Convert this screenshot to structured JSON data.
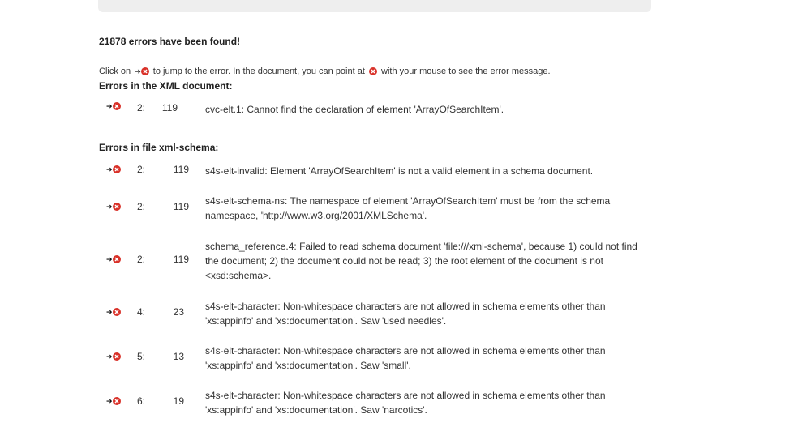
{
  "summary": "21878 errors have been found!",
  "hint": {
    "before": "Click on",
    "middle": "to jump to the error. In the document, you can point at",
    "after": "with your mouse to see the error message."
  },
  "xml_section": {
    "title": "Errors in the XML document:",
    "errors": [
      {
        "line": "2:",
        "col": "119",
        "message": "cvc-elt.1: Cannot find the declaration of element 'ArrayOfSearchItem'."
      }
    ]
  },
  "schema_section": {
    "title": "Errors in file xml-schema:",
    "errors": [
      {
        "line": "2:",
        "col": "119",
        "message": "s4s-elt-invalid: Element 'ArrayOfSearchItem' is not a valid element in a schema document."
      },
      {
        "line": "2:",
        "col": "119",
        "message": "s4s-elt-schema-ns: The namespace of element 'ArrayOfSearchItem' must be from the schema namespace, 'http://www.w3.org/2001/XMLSchema'."
      },
      {
        "line": "2:",
        "col": "119",
        "message": "schema_reference.4: Failed to read schema document 'file:///xml-schema', because 1) could not find the document; 2) the document could not be read; 3) the root element of the document is not <xsd:schema>."
      },
      {
        "line": "4:",
        "col": "23",
        "message": "s4s-elt-character: Non-whitespace characters are not allowed in schema elements other than 'xs:appinfo' and 'xs:documentation'. Saw 'used needles'."
      },
      {
        "line": "5:",
        "col": "13",
        "message": "s4s-elt-character: Non-whitespace characters are not allowed in schema elements other than 'xs:appinfo' and 'xs:documentation'. Saw 'small'."
      },
      {
        "line": "6:",
        "col": "19",
        "message": "s4s-elt-character: Non-whitespace characters are not allowed in schema elements other than 'xs:appinfo' and 'xs:documentation'. Saw 'narcotics'."
      }
    ]
  },
  "colors": {
    "error_icon": "#d9322a",
    "panel": "#eeeeee",
    "text": "#333333"
  },
  "icons": {
    "jump": "jump-arrow-icon",
    "error": "error-x-icon"
  }
}
